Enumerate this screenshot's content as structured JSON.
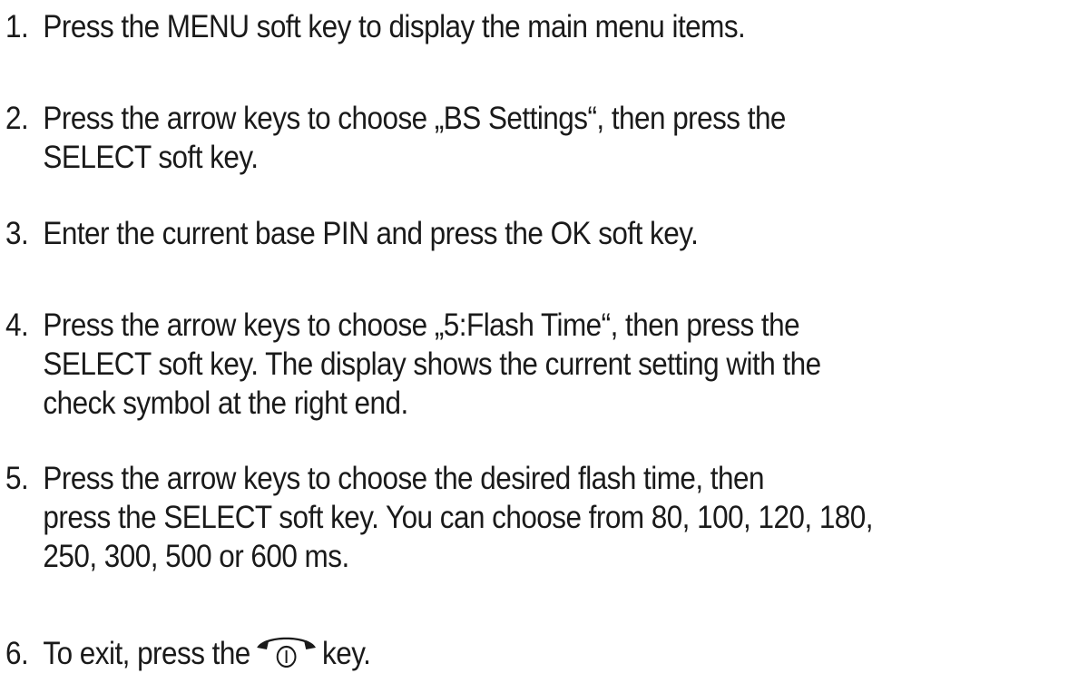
{
  "steps": [
    {
      "number": "1.",
      "lines": [
        "Press the MENU soft key to display the main menu items."
      ]
    },
    {
      "number": "2.",
      "lines": [
        "Press the arrow keys  to choose „BS Settings“, then press the",
        "SELECT soft key."
      ]
    },
    {
      "number": "3.",
      "lines": [
        "Enter the current base PIN and press the OK soft key."
      ]
    },
    {
      "number": "4.",
      "lines": [
        "Press the arrow keys to choose „5:Flash Time“, then press the",
        "SELECT soft key. The display shows the current setting with the",
        "check symbol at the right end."
      ]
    },
    {
      "number": "5.",
      "lines": [
        "Press the arrow keys to choose the desired flash time, then",
        "press the SELECT soft key. You can choose from 80, 100, 120, 180,",
        "250, 300, 500 or 600 ms."
      ]
    },
    {
      "number": "6.",
      "before_icon": "To exit, press the",
      "icon": "end-call-key-icon",
      "after_icon": "key."
    }
  ]
}
